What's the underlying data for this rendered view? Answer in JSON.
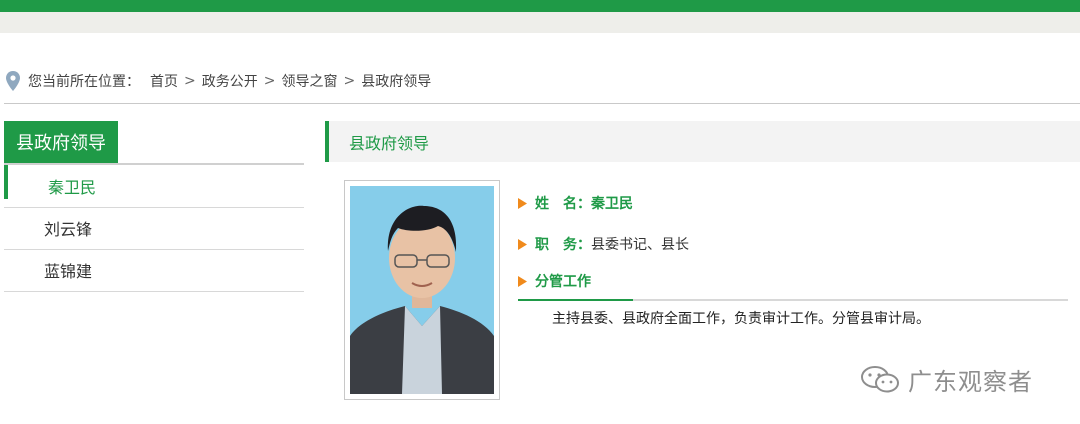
{
  "breadcrumb": {
    "prefix": "您当前所在位置：",
    "items": [
      "首页",
      "政务公开",
      "领导之窗",
      "县政府领导"
    ],
    "separator": ">"
  },
  "sidebar": {
    "title": "县政府领导",
    "items": [
      {
        "label": "秦卫民",
        "active": true
      },
      {
        "label": "刘云锋",
        "active": false
      },
      {
        "label": "蓝锦建",
        "active": false
      }
    ]
  },
  "main": {
    "title": "县政府领导",
    "name_label": "姓　名：",
    "name_value": "秦卫民",
    "position_label": "职　务：",
    "position_value": "县委书记、县长",
    "duty_label": "分管工作",
    "duty_text": "主持县委、县政府全面工作，负责审计工作。分管县审计局。"
  },
  "watermark": {
    "text": "广东观察者",
    "icon": "wechat-icon"
  },
  "colors": {
    "brand_green": "#1f9a47",
    "photo_bg": "#86cdea"
  }
}
